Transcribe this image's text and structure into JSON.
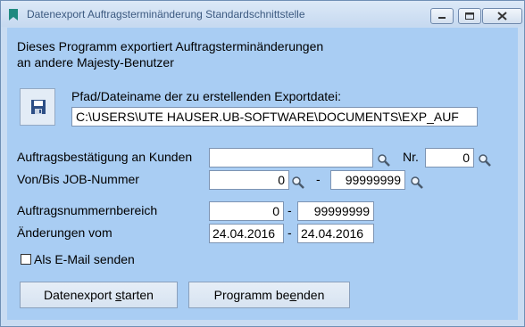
{
  "window": {
    "title": "Datenexport Auftragsterminänderung Standardschnittstelle"
  },
  "intro": {
    "line1": "Dieses Programm exportiert Auftragsterminänderungen",
    "line2": "an andere Majesty-Benutzer"
  },
  "export": {
    "path_label": "Pfad/Dateiname der zu erstellenden Exportdatei:",
    "path_value": "C:\\USERS\\UTE HAUSER.UB-SOFTWARE\\DOCUMENTS\\EXP_AUF"
  },
  "customer": {
    "label": "Auftragsbestätigung an Kunden",
    "value": "",
    "nr_label": "Nr.",
    "nr_value": "0"
  },
  "job": {
    "label": "Von/Bis JOB-Nummer",
    "from": "0",
    "separator": "-",
    "to": "99999999"
  },
  "order_range": {
    "label": "Auftragsnummernbereich",
    "from": "0",
    "separator": "-",
    "to": "99999999"
  },
  "changes": {
    "label": "Änderungen vom",
    "from": "24.04.2016",
    "separator": "-",
    "to": "24.04.2016"
  },
  "email": {
    "label": "Als E-Mail senden",
    "checked": false
  },
  "buttons": {
    "start_pre": "Datenexport ",
    "start_u": "s",
    "start_post": "tarten",
    "quit_pre": "Programm be",
    "quit_u": "e",
    "quit_post": "nden"
  },
  "colors": {
    "client_bg": "#a9cdf3",
    "titlebar_bg": "#c6d9f0",
    "title_text": "#3c5a80"
  },
  "icons": [
    "app-icon",
    "save-icon",
    "magnifier-icon",
    "minimize-icon",
    "maximize-icon",
    "close-icon"
  ]
}
